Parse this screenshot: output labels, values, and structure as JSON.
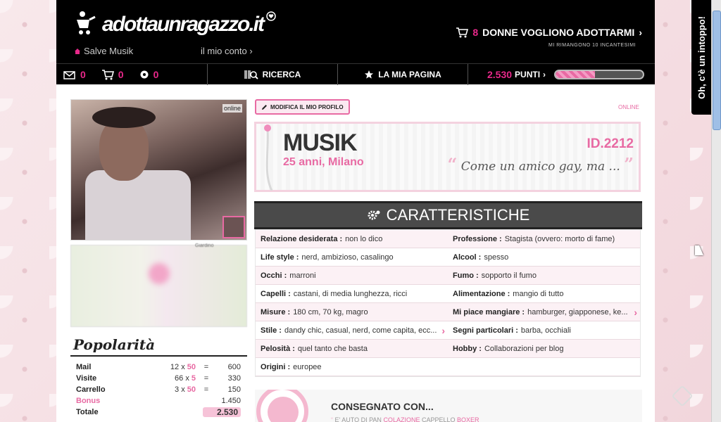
{
  "header": {
    "logo_text": "adottaunragazzo.it",
    "greeting": "Salve Musik",
    "account_link": "il mio conto",
    "donne_count": "8",
    "donne_label": "DONNE VOGLIONO ADOTTARMI",
    "incantesimi": "MI RIMANGONO 10 INCANTESIMI"
  },
  "nav": {
    "mail_count": "0",
    "cart_count": "0",
    "target_count": "0",
    "ricerca": "RICERCA",
    "la_mia_pagina": "LA MIA PAGINA",
    "punti_value": "2.530",
    "punti_label": "PUNTI",
    "punti_progress": 0.45
  },
  "profile": {
    "photo_status": "online",
    "modify_button": "MODIFICA IL MIO PROFILO",
    "status": "ONLINE",
    "name": "MUSIK",
    "age_city": "25 anni, Milano",
    "id": "ID.2212",
    "quote": "Come un amico gay, ma ...",
    "map_label": "Giardino"
  },
  "popularity": {
    "title": "Popolarità",
    "rows": [
      {
        "k": "Mail",
        "a": "12",
        "x": "x",
        "b": "50",
        "eq": "=",
        "r": "600"
      },
      {
        "k": "Visite",
        "a": "66",
        "x": "x",
        "b": "5",
        "eq": "=",
        "r": "330"
      },
      {
        "k": "Carrello",
        "a": "3",
        "x": "x",
        "b": "50",
        "eq": "=",
        "r": "150"
      },
      {
        "k": "Bonus",
        "a": "",
        "x": "",
        "b": "",
        "eq": "",
        "r": "1.450"
      },
      {
        "k": "Totale",
        "a": "",
        "x": "",
        "b": "",
        "eq": "",
        "r": "2.530"
      }
    ]
  },
  "caratteristiche": {
    "title": "CARATTERISTICHE",
    "rows": [
      [
        {
          "k": "Relazione desiderata :",
          "v": "non lo dico"
        },
        {
          "k": "Professione :",
          "v": "Stagista (ovvero: morto di fame)"
        }
      ],
      [
        {
          "k": "Life style :",
          "v": "nerd, ambizioso, casalingo"
        },
        {
          "k": "Alcool :",
          "v": "spesso"
        }
      ],
      [
        {
          "k": "Occhi :",
          "v": "marroni"
        },
        {
          "k": "Fumo :",
          "v": "sopporto il fumo"
        }
      ],
      [
        {
          "k": "Capelli :",
          "v": "castani, di media lunghezza, ricci"
        },
        {
          "k": "Alimentazione :",
          "v": "mangio di tutto"
        }
      ],
      [
        {
          "k": "Misure :",
          "v": "180 cm, 70 kg, magro"
        },
        {
          "k": "Mi piace mangiare :",
          "v": "hamburger, giapponese, ke..."
        }
      ],
      [
        {
          "k": "Stile :",
          "v": "dandy chic, casual, nerd, come capita, ecc..."
        },
        {
          "k": "Segni particolari :",
          "v": "barba, occhiali"
        }
      ],
      [
        {
          "k": "Pelosità :",
          "v": "quel tanto che basta"
        },
        {
          "k": "Hobby :",
          "v": "Collaborazioni per blog"
        }
      ],
      [
        {
          "k": "Origini :",
          "v": "europee"
        },
        {
          "k": "",
          "v": ""
        }
      ]
    ]
  },
  "delivery": {
    "title": "CONSEGNATO CON...",
    "line_a": "E' AUTO DI PAN",
    "line_b": "COLAZIONE",
    "line_c": "CAPPELLO",
    "line_d": "BOXER"
  },
  "feedback_tab": "Oh, c'è un intoppo!",
  "colors": {
    "accent": "#e8288a",
    "pink": "#e86aa3",
    "header": "#000000"
  }
}
